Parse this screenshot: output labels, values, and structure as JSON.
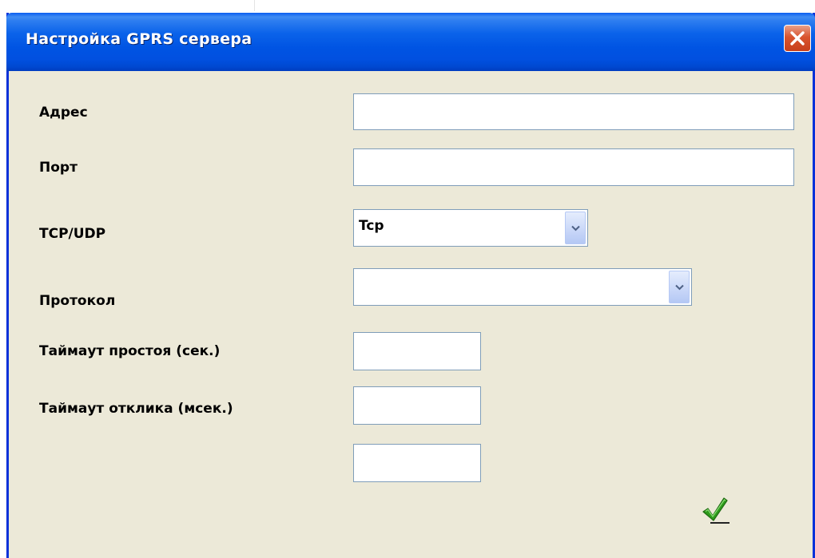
{
  "dialog": {
    "title": "Настройка GPRS сервера"
  },
  "form": {
    "address_label": "Адрес",
    "address_value": "",
    "port_label": "Порт",
    "port_value": "",
    "transport_label": "TCP/UDP",
    "transport_selected": "Tcp",
    "protocol_label": "Протокол",
    "protocol_selected": "",
    "idle_timeout_label": "Таймаут простоя (сек.)",
    "idle_timeout_value": "",
    "response_timeout_label": "Таймаут отклика (мсек.)",
    "response_timeout_value": "",
    "extra_value": ""
  },
  "icons": {
    "close": "close-icon",
    "dropdown": "chevron-down-icon",
    "ok": "green-checkmark-icon"
  },
  "colors": {
    "titlebar": "#0054e3",
    "window_bg": "#ece9d8",
    "close_button": "#d9542e",
    "input_border": "#7f9db9",
    "checkmark": "#2f9c1c"
  }
}
